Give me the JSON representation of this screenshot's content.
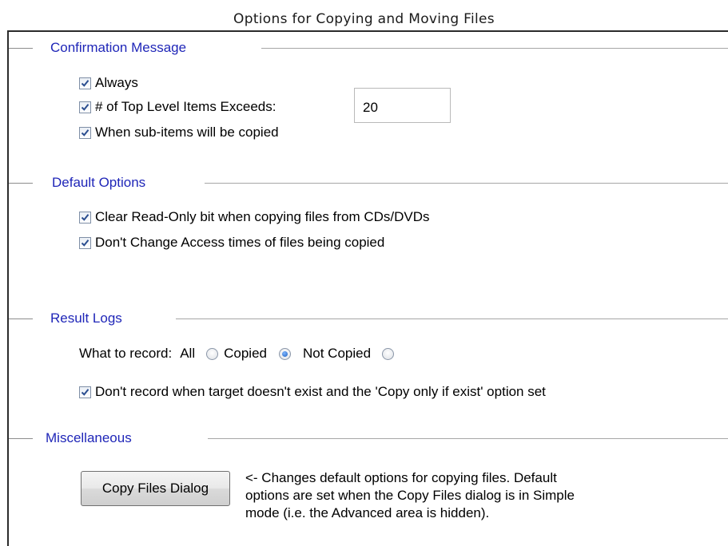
{
  "page_title": "Options for Copying and Moving Files",
  "sections": {
    "confirmation": {
      "title": "Confirmation Message",
      "always_label": "Always",
      "top_level_label": "# of Top Level Items Exceeds:",
      "top_level_value": "20",
      "subitems_label": "When sub-items will be copied"
    },
    "default_options": {
      "title": "Default Options",
      "clear_readonly_label": "Clear Read-Only bit when copying files from CDs/DVDs",
      "access_times_label": "Don't Change Access times of files being copied"
    },
    "result_logs": {
      "title": "Result Logs",
      "what_to_record_label": "What to record:",
      "options": [
        {
          "label": "All",
          "selected": false
        },
        {
          "label": "Copied",
          "selected": true
        },
        {
          "label": "Not Copied",
          "selected": false
        }
      ],
      "dont_record_label": "Don't record when target doesn't exist and the 'Copy only if exist' option set"
    },
    "miscellaneous": {
      "title": "Miscellaneous",
      "copy_files_button": "Copy Files Dialog",
      "description": "<- Changes default options for copying files. Default\noptions are set when the Copy Files dialog is in Simple\nmode (i.e. the Advanced area is hidden)."
    }
  },
  "checkboxes": {
    "always": true,
    "top_level": true,
    "subitems": true,
    "clear_readonly": true,
    "access_times": true,
    "dont_record": true
  },
  "colors": {
    "section_title": "#1f26b8",
    "rule": "#a6a6a6",
    "frame": "#2b2b2b"
  }
}
